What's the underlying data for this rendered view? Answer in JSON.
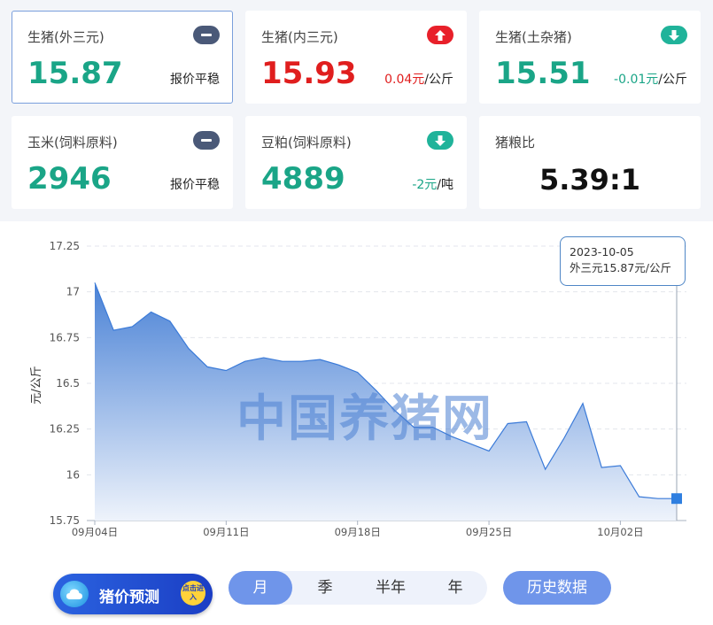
{
  "cards": [
    {
      "name": "生猪(外三元)",
      "price": "15.87",
      "change_num": "",
      "change_unit": "",
      "change_text": "报价平稳",
      "trend": "flat"
    },
    {
      "name": "生猪(内三元)",
      "price": "15.93",
      "change_num": "0.04元",
      "change_unit": "/公斤",
      "change_text": "",
      "trend": "up"
    },
    {
      "name": "生猪(土杂猪)",
      "price": "15.51",
      "change_num": "-0.01元",
      "change_unit": "/公斤",
      "change_text": "",
      "trend": "down"
    },
    {
      "name": "玉米(饲料原料)",
      "price": "2946",
      "change_num": "",
      "change_unit": "",
      "change_text": "报价平稳",
      "trend": "flat"
    },
    {
      "name": "豆粕(饲料原料)",
      "price": "4889",
      "change_num": "-2元",
      "change_unit": "/吨",
      "change_text": "",
      "trend": "down"
    },
    {
      "name": "猪粮比",
      "value": "5.39:1"
    }
  ],
  "tooltip": {
    "date": "2023-10-05",
    "text": "外三元15.87元/公斤"
  },
  "watermark": "中国养猪网",
  "chart_data": {
    "type": "area",
    "ylabel": "元/公斤",
    "ylim": [
      15.75,
      17.25
    ],
    "yticks": [
      "15.75",
      "16",
      "16.25",
      "16.5",
      "16.75",
      "17",
      "17.25"
    ],
    "xticks": [
      {
        "label": "09月04日",
        "day": 0
      },
      {
        "label": "09月11日",
        "day": 7
      },
      {
        "label": "09月18日",
        "day": 14
      },
      {
        "label": "09月25日",
        "day": 21
      },
      {
        "label": "10月02日",
        "day": 28
      }
    ],
    "x": [
      "09-04",
      "09-05",
      "09-06",
      "09-07",
      "09-08",
      "09-09",
      "09-10",
      "09-11",
      "09-12",
      "09-13",
      "09-14",
      "09-15",
      "09-16",
      "09-17",
      "09-18",
      "09-19",
      "09-20",
      "09-21",
      "09-22",
      "09-23",
      "09-24",
      "09-25",
      "09-26",
      "09-27",
      "09-28",
      "09-29",
      "09-30",
      "10-01",
      "10-02",
      "10-03",
      "10-04",
      "10-05"
    ],
    "series": [
      {
        "values": [
          17.05,
          16.79,
          16.81,
          16.89,
          16.84,
          16.69,
          16.59,
          16.57,
          16.62,
          16.64,
          16.62,
          16.62,
          16.63,
          16.6,
          16.56,
          16.46,
          16.35,
          16.26,
          16.26,
          16.21,
          16.17,
          16.13,
          16.28,
          16.29,
          16.03,
          16.2,
          16.39,
          16.04,
          16.05,
          15.88,
          15.87,
          15.87
        ]
      }
    ],
    "grid": true,
    "colors": {
      "line": "#3a7ad8",
      "fill_top": "#4f86d9",
      "fill_bottom": "#eef3fb",
      "marker": "#2f7fe0"
    }
  },
  "controls": {
    "forecast": {
      "label": "猪价预测",
      "enter": "点击进入"
    },
    "periods": [
      "月",
      "季",
      "半年",
      "年"
    ],
    "active_period": "月",
    "history": "历史数据"
  }
}
